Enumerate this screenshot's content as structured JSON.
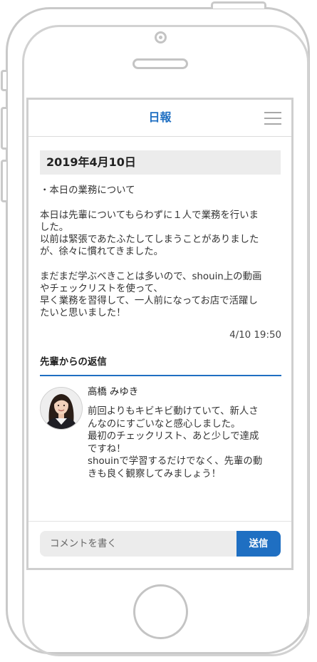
{
  "header": {
    "title": "日報",
    "menu_icon": "hamburger-menu-icon"
  },
  "report": {
    "date": "2019年4月10日",
    "lines": [
      "・本日の業務について",
      "本日は先輩についてもらわずに１人で業務を行いま",
      "した。",
      "以前は緊張であたふたしてしまうことがありました",
      "が、徐々に慣れてきました。",
      "まだまだ学ぶべきことは多いので、shouin上の動画",
      "やチェックリストを使って、",
      "早く業務を習得して、一人前になってお店で活躍し",
      "たいと思いました！"
    ],
    "timestamp": "4/10 19:50"
  },
  "replies": {
    "heading": "先輩からの返信",
    "accent_color": "#1f6fc2",
    "items": [
      {
        "avatar": "avatar-woman-photo",
        "name": "高橋 みゆき",
        "lines": [
          "前回よりもキビキビ動けていて、新人さ",
          "んなのにすごいなと感心しました。",
          "最初のチェックリスト、あと少しで達成",
          "ですね！",
          "shouinで学習するだけでなく、先輩の動",
          "きも良く観察してみましょう！"
        ]
      }
    ]
  },
  "composer": {
    "placeholder": "コメントを書く",
    "value": "",
    "send_label": "送信",
    "send_color": "#1f6fc2"
  }
}
